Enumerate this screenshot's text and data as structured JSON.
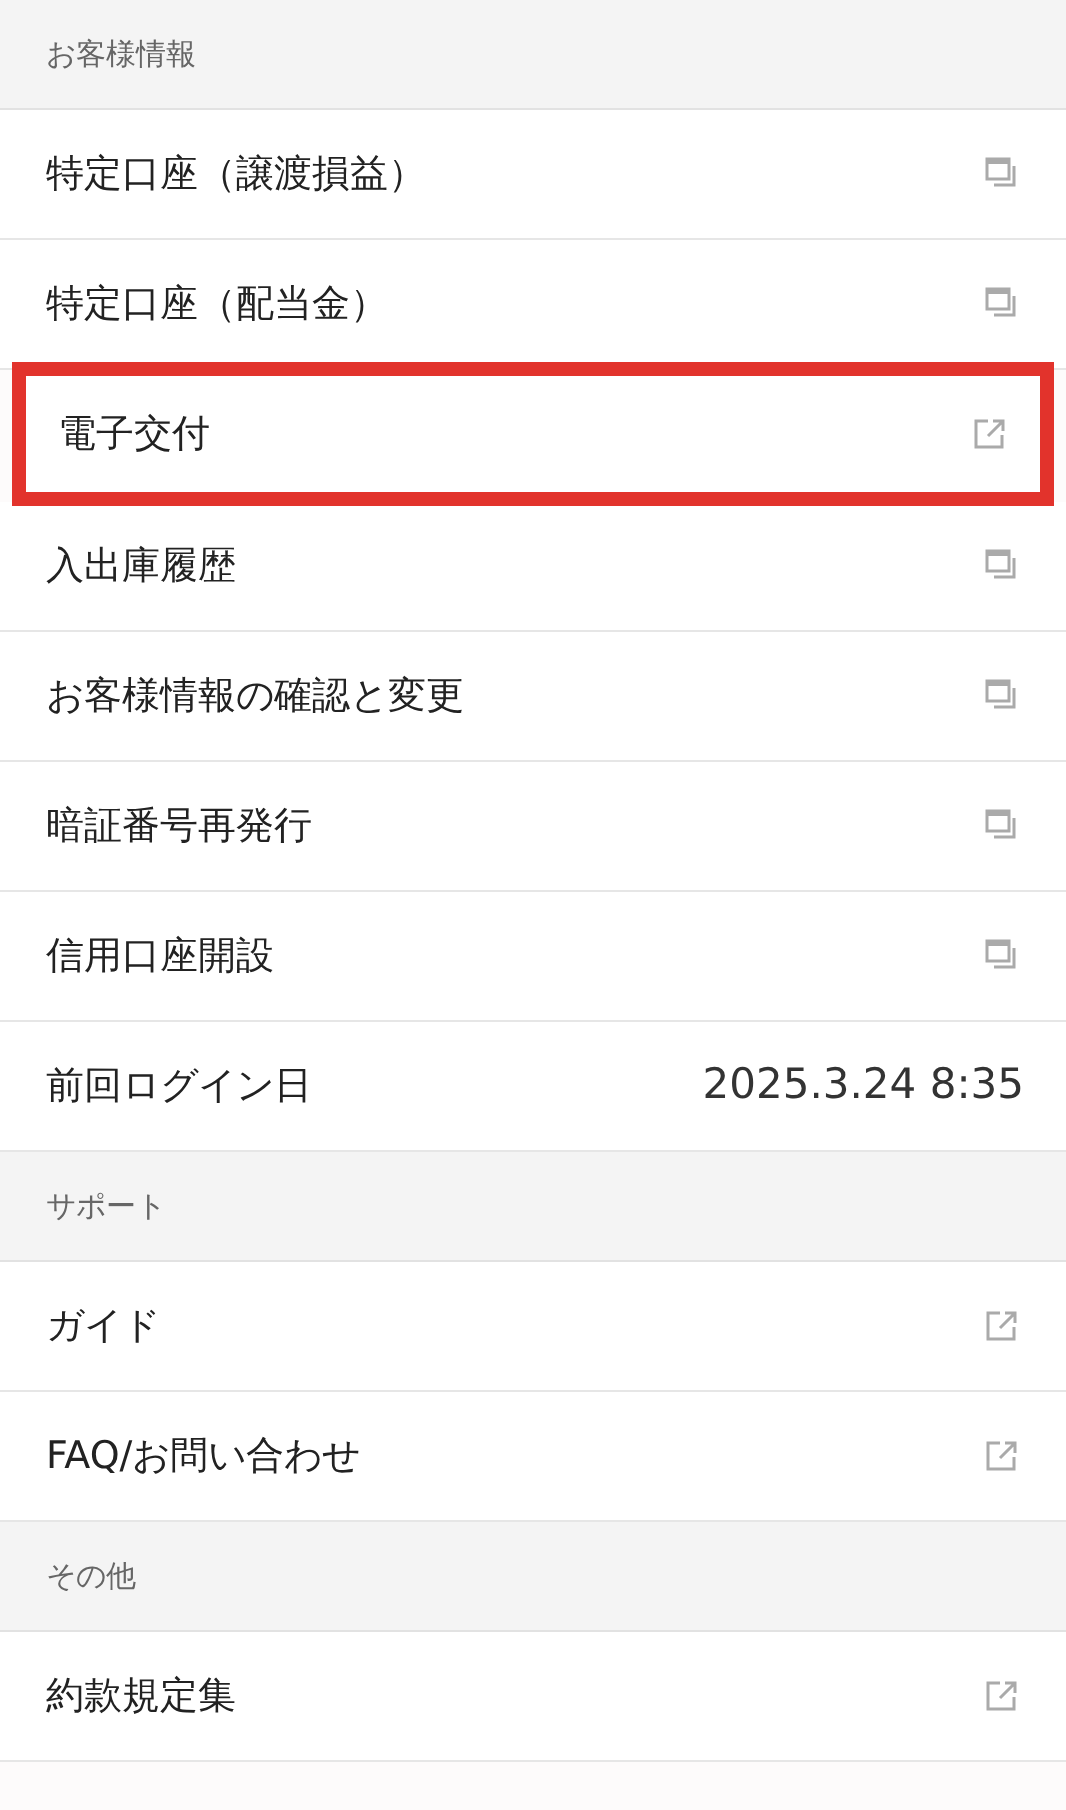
{
  "sections": [
    {
      "heading": "お客様情報",
      "items": [
        {
          "label": "特定口座（譲渡損益）",
          "kind": "window",
          "highlighted": false
        },
        {
          "label": "特定口座（配当金）",
          "kind": "window",
          "highlighted": false
        },
        {
          "label": "電子交付",
          "kind": "external",
          "highlighted": true
        },
        {
          "label": "入出庫履歴",
          "kind": "window",
          "highlighted": false
        },
        {
          "label": "お客様情報の確認と変更",
          "kind": "window",
          "highlighted": false
        },
        {
          "label": "暗証番号再発行",
          "kind": "window",
          "highlighted": false
        },
        {
          "label": "信用口座開設",
          "kind": "window",
          "highlighted": false
        },
        {
          "label": "前回ログイン日",
          "kind": "value",
          "value": "2025.3.24 8:35",
          "highlighted": false
        }
      ]
    },
    {
      "heading": "サポート",
      "items": [
        {
          "label": "ガイド",
          "kind": "external",
          "highlighted": false
        },
        {
          "label": "FAQ/お問い合わせ",
          "kind": "external",
          "highlighted": false
        }
      ]
    },
    {
      "heading": "その他",
      "items": [
        {
          "label": "約款規定集",
          "kind": "external",
          "highlighted": false
        }
      ]
    }
  ]
}
